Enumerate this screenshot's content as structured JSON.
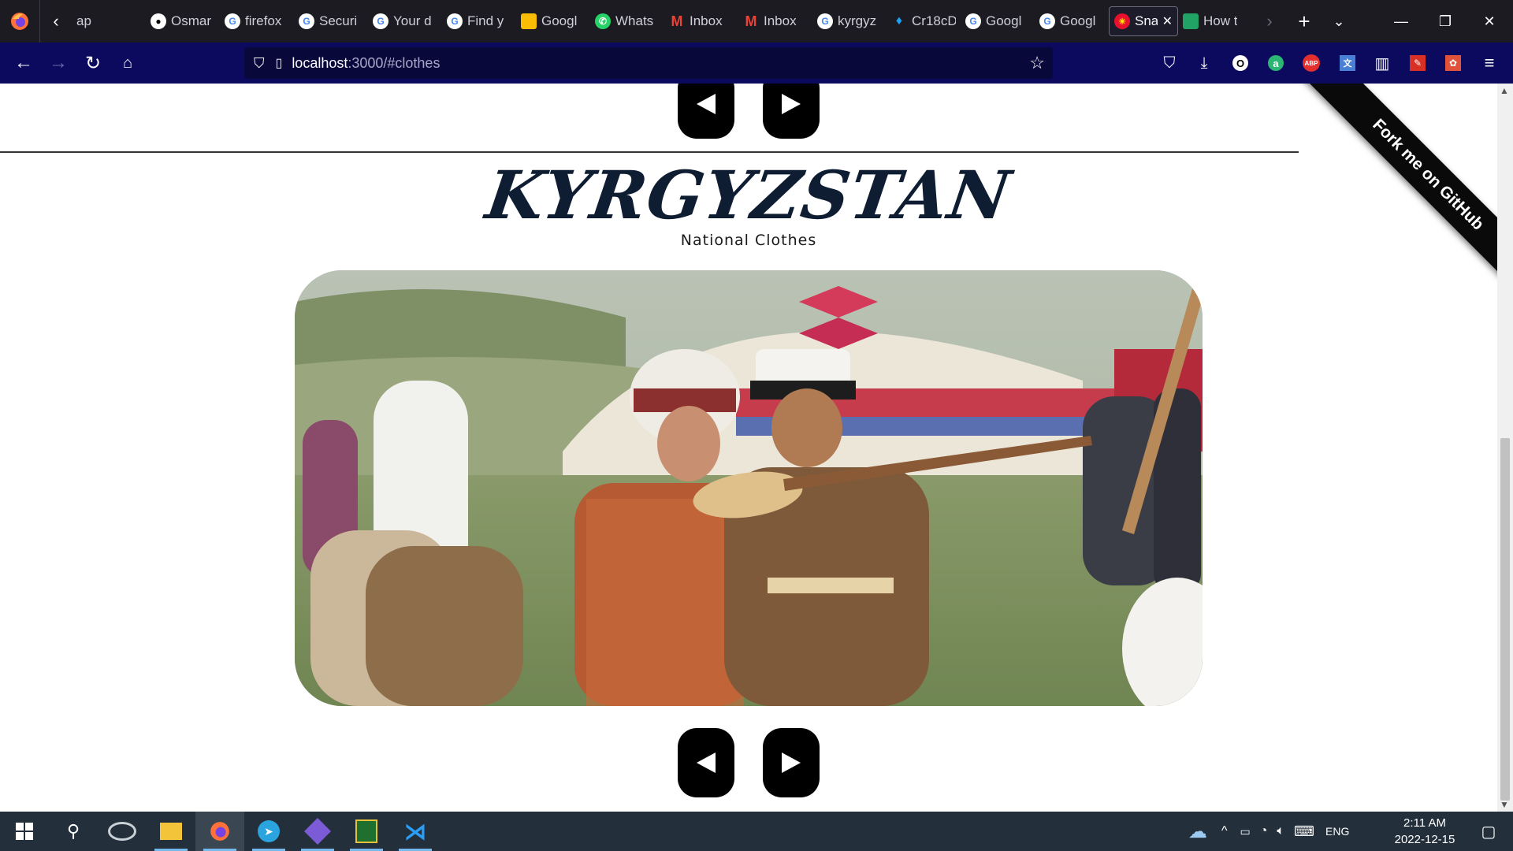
{
  "browser": {
    "tabs": [
      {
        "label": "ap",
        "icon": "generic-page-icon"
      },
      {
        "label": "Osmar",
        "icon": "github-icon"
      },
      {
        "label": "firefox",
        "icon": "google-icon"
      },
      {
        "label": "Securi",
        "icon": "google-icon"
      },
      {
        "label": "Your d",
        "icon": "google-icon"
      },
      {
        "label": "Find y",
        "icon": "google-icon"
      },
      {
        "label": "Googl",
        "icon": "google-keep-icon"
      },
      {
        "label": "Whats",
        "icon": "whatsapp-icon"
      },
      {
        "label": "Inbox",
        "icon": "gmail-icon"
      },
      {
        "label": "Inbox",
        "icon": "gmail-icon"
      },
      {
        "label": "kyrgyz",
        "icon": "google-icon"
      },
      {
        "label": "Cr18cD",
        "icon": "twitter-icon"
      },
      {
        "label": "Googl",
        "icon": "google-icon"
      },
      {
        "label": "Googl",
        "icon": "google-icon"
      },
      {
        "label": "Sna",
        "icon": "site-favicon-icon",
        "active": true
      },
      {
        "label": "How t",
        "icon": "bookmark-page-icon"
      }
    ],
    "url_host": "localhost",
    "url_rest": ":3000/#clothes",
    "colors": {
      "tabstrip": "#1c1b22",
      "navbar": "#0b0a5e",
      "urlbar": "#09083a"
    }
  },
  "page": {
    "title": "KYRGYZSTAN",
    "subtitle": "National Clothes",
    "ribbon": "Fork me on GitHub",
    "prev_icon": "triangle-left-icon",
    "next_icon": "triangle-right-icon",
    "image_icon": "photo-national-clothes"
  },
  "taskbar": {
    "lang": "ENG",
    "time": "2:11 AM",
    "date": "2022-12-15"
  }
}
